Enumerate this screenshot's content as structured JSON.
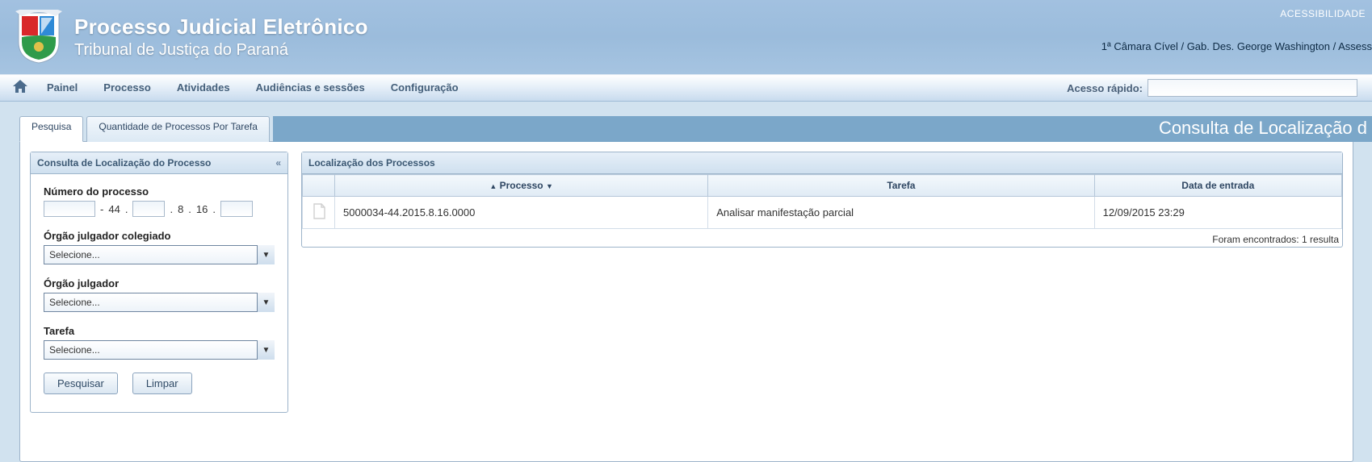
{
  "header": {
    "title": "Processo Judicial Eletrônico",
    "subtitle": "Tribunal de Justiça do Paraná",
    "accessibility_label": "ACESSIBILIDADE",
    "context_line": "1ª Câmara Cível / Gab. Des. George Washington / Assess"
  },
  "nav": {
    "items": [
      "Painel",
      "Processo",
      "Atividades",
      "Audiências e sessões",
      "Configuração"
    ],
    "quick_access_label": "Acesso rápido:",
    "quick_access_value": ""
  },
  "tabs": {
    "active": "Pesquisa",
    "items": [
      "Pesquisa",
      "Quantidade de Processos Por Tarefa"
    ],
    "page_heading": "Consulta de Localização d"
  },
  "sidebar": {
    "title": "Consulta de Localização do Processo",
    "collapse_glyph": "«",
    "process_number_label": "Número do processo",
    "process_number": {
      "seq": "",
      "dv": "44",
      "year": "",
      "j": "8",
      "tr": "16",
      "origin": ""
    },
    "orgao_colegiado_label": "Órgão julgador colegiado",
    "orgao_colegiado_value": "Selecione...",
    "orgao_julgador_label": "Órgão julgador",
    "orgao_julgador_value": "Selecione...",
    "tarefa_label": "Tarefa",
    "tarefa_value": "Selecione...",
    "search_btn": "Pesquisar",
    "clear_btn": "Limpar"
  },
  "results": {
    "title": "Localização dos Processos",
    "columns": {
      "processo": "Processo",
      "tarefa": "Tarefa",
      "data_entrada": "Data de entrada"
    },
    "rows": [
      {
        "processo": "5000034-44.2015.8.16.0000",
        "tarefa": "Analisar manifestação parcial",
        "data_entrada": "12/09/2015 23:29"
      }
    ],
    "footer": "Foram encontrados: 1 resulta"
  }
}
